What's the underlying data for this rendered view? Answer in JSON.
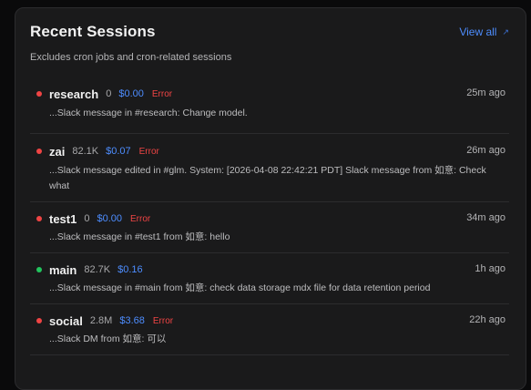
{
  "card": {
    "title": "Recent Sessions",
    "view_all_label": "View all",
    "view_all_icon": "external-arrow-icon",
    "subtitle": "Excludes cron jobs and cron-related sessions"
  },
  "colors": {
    "accent": "#4d8dff",
    "error": "#ef4444",
    "ok": "#22c55e"
  },
  "sessions": [
    {
      "name": "research",
      "tokens": "0",
      "cost": "$0.00",
      "status": "error",
      "error_label": "Error",
      "time": "25m ago",
      "snippet": "...Slack message in #research: Change model."
    },
    {
      "name": "zai",
      "tokens": "82.1K",
      "cost": "$0.07",
      "status": "error",
      "error_label": "Error",
      "time": "26m ago",
      "snippet": "...Slack message edited in #glm. System: [2026-04-08 22:42:21 PDT] Slack message from 如意: Check what"
    },
    {
      "name": "test1",
      "tokens": "0",
      "cost": "$0.00",
      "status": "error",
      "error_label": "Error",
      "time": "34m ago",
      "snippet": "...Slack message in #test1 from 如意: hello"
    },
    {
      "name": "main",
      "tokens": "82.7K",
      "cost": "$0.16",
      "status": "ok",
      "error_label": "",
      "time": "1h ago",
      "snippet": "...Slack message in #main from 如意: check data storage mdx file for data retention period"
    },
    {
      "name": "social",
      "tokens": "2.8M",
      "cost": "$3.68",
      "status": "error",
      "error_label": "Error",
      "time": "22h ago",
      "snippet": "...Slack DM from 如意: 可以"
    }
  ]
}
